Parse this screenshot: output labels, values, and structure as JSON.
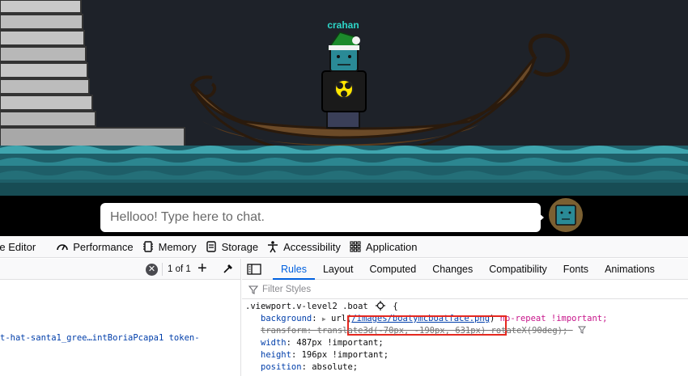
{
  "game": {
    "player_name": "crahan",
    "chat_placeholder": "Hellooo! Type here to chat."
  },
  "devtools": {
    "tabs": [
      {
        "label": "yle Editor",
        "icon": "style-editor-icon"
      },
      {
        "label": "Performance",
        "icon": "performance-gauge-icon"
      },
      {
        "label": "Memory",
        "icon": "memory-chip-icon"
      },
      {
        "label": "Storage",
        "icon": "storage-icon"
      },
      {
        "label": "Accessibility",
        "icon": "accessibility-person-icon"
      },
      {
        "label": "Application",
        "icon": "application-grid-icon"
      }
    ],
    "markup": {
      "match_count": "1 of 1",
      "node_text": "t-hat-santa1_gree…intBoriaPcapa1 token-"
    },
    "sidebar_tabs": [
      "Rules",
      "Layout",
      "Computed",
      "Changes",
      "Compatibility",
      "Fonts",
      "Animations"
    ],
    "active_sidebar_tab": "Rules",
    "filter_placeholder": "Filter Styles",
    "rule": {
      "selector": ".viewport.v-level2 .boat",
      "open_brace": "{",
      "declarations": [
        {
          "prop": "background",
          "value_prefix": "url(",
          "url": "/images/boatymcboatface.png",
          "value_suffix": ")",
          "keywords": "no-repeat !important;"
        },
        {
          "prop": "transform",
          "value": "translate3d(-70px, -190px, 631px) rotateX(90deg);"
        },
        {
          "prop": "width",
          "value": "487px !important;"
        },
        {
          "prop": "height",
          "value": "196px !important;"
        },
        {
          "prop": "position",
          "value": "absolute;"
        }
      ]
    }
  },
  "colors": {
    "accent": "#0060df",
    "highlight": "#e5281f",
    "player_name": "#2dd6c8"
  }
}
